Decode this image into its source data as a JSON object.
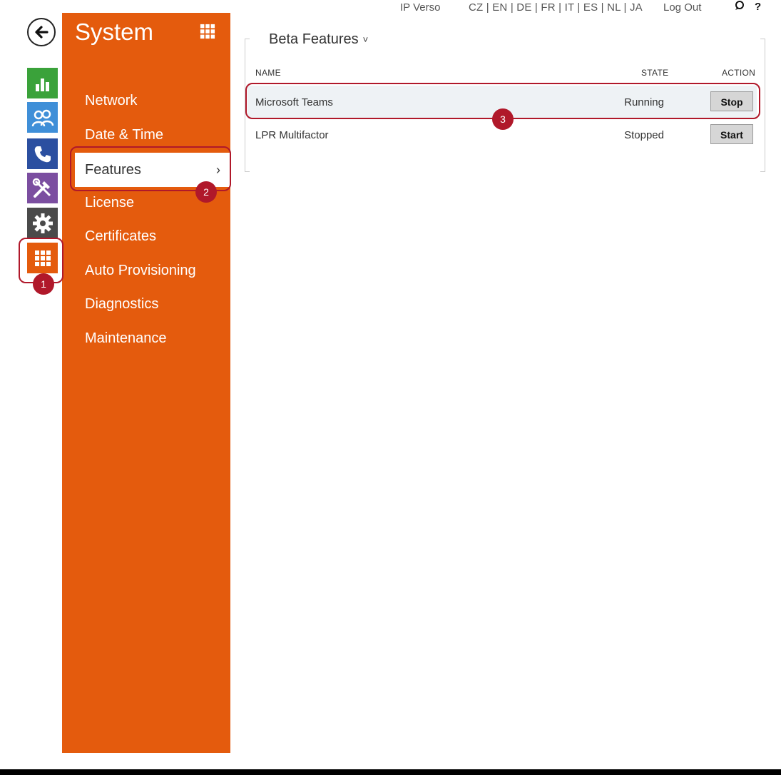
{
  "topbar": {
    "device": "IP Verso",
    "languages": "CZ | EN | DE | FR | IT | ES | NL | JA",
    "logout": "Log Out",
    "help": "?"
  },
  "rail": {
    "icons": [
      "back-arrow-icon",
      "status-chart-icon",
      "directory-users-icon",
      "calls-phone-icon",
      "hardware-tools-icon",
      "services-gear-icon",
      "system-grid-icon"
    ]
  },
  "sidebar": {
    "title": "System",
    "items": [
      {
        "label": "Network"
      },
      {
        "label": "Date & Time"
      },
      {
        "label": "Features",
        "chevron": "›"
      },
      {
        "label": "License"
      },
      {
        "label": "Certificates"
      },
      {
        "label": "Auto Provisioning"
      },
      {
        "label": "Diagnostics"
      },
      {
        "label": "Maintenance"
      }
    ]
  },
  "main": {
    "section_title": "Beta Features",
    "caret": "˅",
    "columns": {
      "name": "NAME",
      "state": "STATE",
      "action": "ACTION"
    },
    "rows": [
      {
        "name": "Microsoft Teams",
        "state": "Running",
        "action": "Stop"
      },
      {
        "name": "LPR Multifactor",
        "state": "Stopped",
        "action": "Start"
      }
    ]
  },
  "callouts": {
    "one": "1",
    "two": "2",
    "three": "3"
  },
  "colors": {
    "accent": "#e45b0d",
    "callout": "#b0182a"
  }
}
